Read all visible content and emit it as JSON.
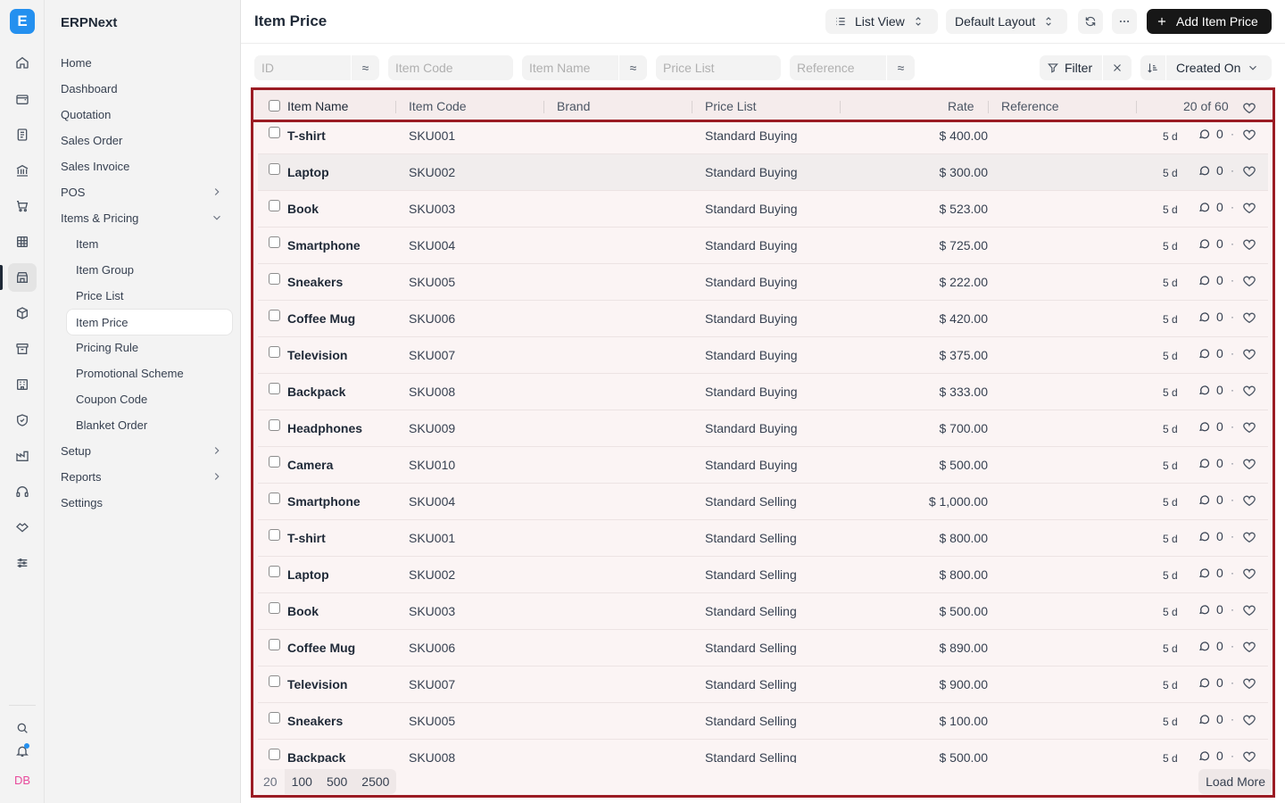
{
  "app": {
    "name": "ERPNext",
    "logo_letter": "E",
    "brand_color": "#2490ef"
  },
  "rail": {
    "icons": [
      "home-icon",
      "wallet-icon",
      "document-icon",
      "bank-icon",
      "cart-icon",
      "table-icon",
      "store-icon",
      "box-icon",
      "archive-icon",
      "building-icon",
      "shield-icon",
      "factory-icon",
      "headset-icon",
      "handshake-icon",
      "sliders-icon"
    ],
    "bottom_icons": [
      "search-icon",
      "bell-icon"
    ],
    "avatar_initials": "DB"
  },
  "sidebar": {
    "items": [
      {
        "label": "Home"
      },
      {
        "label": "Dashboard"
      },
      {
        "label": "Quotation"
      },
      {
        "label": "Sales Order"
      },
      {
        "label": "Sales Invoice"
      },
      {
        "label": "POS"
      },
      {
        "label": "Items & Pricing"
      },
      {
        "label": "Item"
      },
      {
        "label": "Item Group"
      },
      {
        "label": "Price List"
      },
      {
        "label": "Item Price"
      },
      {
        "label": "Pricing Rule"
      },
      {
        "label": "Promotional Scheme"
      },
      {
        "label": "Coupon Code"
      },
      {
        "label": "Blanket Order"
      },
      {
        "label": "Setup"
      },
      {
        "label": "Reports"
      },
      {
        "label": "Settings"
      }
    ]
  },
  "header": {
    "title": "Item Price",
    "view_label": "List View",
    "layout_label": "Default Layout",
    "add_label": "Add Item Price"
  },
  "filters": {
    "id_placeholder": "ID",
    "item_code_placeholder": "Item Code",
    "item_name_placeholder": "Item Name",
    "price_list_placeholder": "Price List",
    "reference_placeholder": "Reference",
    "approx_symbol": "≈",
    "filter_label": "Filter",
    "sort_label": "Created On"
  },
  "table": {
    "columns": [
      "Item Name",
      "Item Code",
      "Brand",
      "Price List",
      "Rate",
      "Reference"
    ],
    "count_label": "20 of 60",
    "rows": [
      {
        "name": "T-shirt",
        "code": "SKU001",
        "price_list": "Standard Buying",
        "rate": "$ 400.00",
        "age": "5 d",
        "comments": "0"
      },
      {
        "name": "Laptop",
        "code": "SKU002",
        "price_list": "Standard Buying",
        "rate": "$ 300.00",
        "age": "5 d",
        "comments": "0"
      },
      {
        "name": "Book",
        "code": "SKU003",
        "price_list": "Standard Buying",
        "rate": "$ 523.00",
        "age": "5 d",
        "comments": "0"
      },
      {
        "name": "Smartphone",
        "code": "SKU004",
        "price_list": "Standard Buying",
        "rate": "$ 725.00",
        "age": "5 d",
        "comments": "0"
      },
      {
        "name": "Sneakers",
        "code": "SKU005",
        "price_list": "Standard Buying",
        "rate": "$ 222.00",
        "age": "5 d",
        "comments": "0"
      },
      {
        "name": "Coffee Mug",
        "code": "SKU006",
        "price_list": "Standard Buying",
        "rate": "$ 420.00",
        "age": "5 d",
        "comments": "0"
      },
      {
        "name": "Television",
        "code": "SKU007",
        "price_list": "Standard Buying",
        "rate": "$ 375.00",
        "age": "5 d",
        "comments": "0"
      },
      {
        "name": "Backpack",
        "code": "SKU008",
        "price_list": "Standard Buying",
        "rate": "$ 333.00",
        "age": "5 d",
        "comments": "0"
      },
      {
        "name": "Headphones",
        "code": "SKU009",
        "price_list": "Standard Buying",
        "rate": "$ 700.00",
        "age": "5 d",
        "comments": "0"
      },
      {
        "name": "Camera",
        "code": "SKU010",
        "price_list": "Standard Buying",
        "rate": "$ 500.00",
        "age": "5 d",
        "comments": "0"
      },
      {
        "name": "Smartphone",
        "code": "SKU004",
        "price_list": "Standard Selling",
        "rate": "$ 1,000.00",
        "age": "5 d",
        "comments": "0"
      },
      {
        "name": "T-shirt",
        "code": "SKU001",
        "price_list": "Standard Selling",
        "rate": "$ 800.00",
        "age": "5 d",
        "comments": "0"
      },
      {
        "name": "Laptop",
        "code": "SKU002",
        "price_list": "Standard Selling",
        "rate": "$ 800.00",
        "age": "5 d",
        "comments": "0"
      },
      {
        "name": "Book",
        "code": "SKU003",
        "price_list": "Standard Selling",
        "rate": "$ 500.00",
        "age": "5 d",
        "comments": "0"
      },
      {
        "name": "Coffee Mug",
        "code": "SKU006",
        "price_list": "Standard Selling",
        "rate": "$ 890.00",
        "age": "5 d",
        "comments": "0"
      },
      {
        "name": "Television",
        "code": "SKU007",
        "price_list": "Standard Selling",
        "rate": "$ 900.00",
        "age": "5 d",
        "comments": "0"
      },
      {
        "name": "Sneakers",
        "code": "SKU005",
        "price_list": "Standard Selling",
        "rate": "$ 100.00",
        "age": "5 d",
        "comments": "0"
      },
      {
        "name": "Backpack",
        "code": "SKU008",
        "price_list": "Standard Selling",
        "rate": "$ 500.00",
        "age": "5 d",
        "comments": "0"
      }
    ]
  },
  "pagination": {
    "sizes": [
      "20",
      "100",
      "500",
      "2500"
    ],
    "load_more_label": "Load More"
  },
  "colors": {
    "highlight_border": "#9b1c24",
    "primary_button": "#171717"
  }
}
